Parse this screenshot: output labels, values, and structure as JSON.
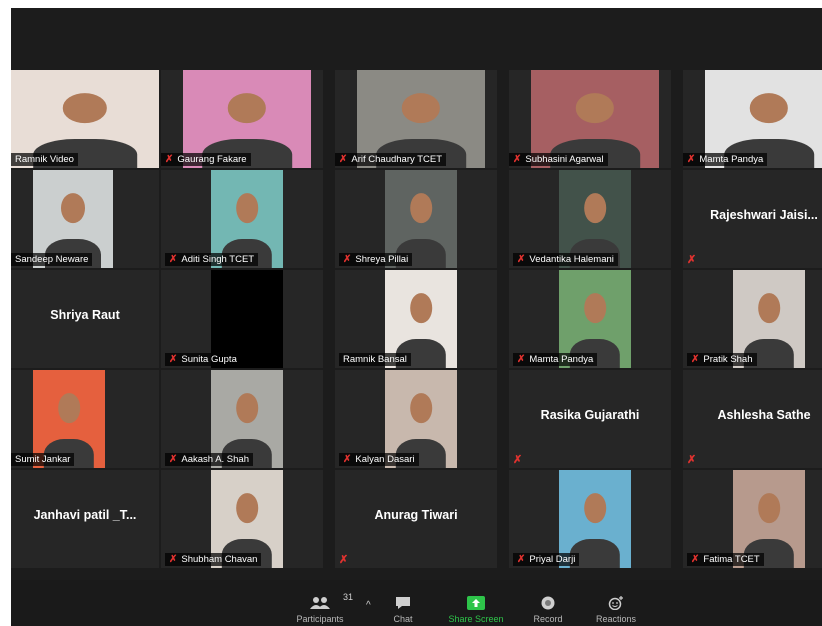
{
  "participants": [
    {
      "name": "Ramnik Video",
      "muted": false,
      "video": true,
      "active": true,
      "bg": "#e8ddd6"
    },
    {
      "name": "Gaurang Fakare",
      "muted": true,
      "video": true,
      "bg": "#d98ab7"
    },
    {
      "name": "Arif Chaudhary TCET",
      "muted": true,
      "video": true,
      "bg": "#8b8a84"
    },
    {
      "name": "Subhasini Agarwal",
      "muted": true,
      "video": true,
      "bg": "#a65f62"
    },
    {
      "name": "Mamta Pandya",
      "muted": true,
      "video": true,
      "bg": "#e2e2e2"
    },
    {
      "name": "Sandeep Neware",
      "muted": false,
      "video": true,
      "bg": "#cbcfcf"
    },
    {
      "name": "Aditi Singh TCET",
      "muted": true,
      "video": true,
      "bg": "#73b7b3"
    },
    {
      "name": "Shreya Pillai",
      "muted": true,
      "video": true,
      "bg": "#5f6461"
    },
    {
      "name": "Vedantika Halemani",
      "muted": true,
      "video": true,
      "bg": "#42524a"
    },
    {
      "name": "Rajeshwari  Jaisi...",
      "muted": true,
      "video": false
    },
    {
      "name": "Shriya Raut",
      "muted": false,
      "video": false
    },
    {
      "name": "Sunita Gupta",
      "muted": true,
      "video": true,
      "bg": "#000000"
    },
    {
      "name": "Ramnik Bansal",
      "muted": false,
      "video": true,
      "bg": "#e9e4df"
    },
    {
      "name": "Mamta Pandya",
      "muted": true,
      "video": true,
      "bg": "#6fa06b"
    },
    {
      "name": "Pratik Shah",
      "muted": true,
      "video": true,
      "bg": "#cfc9c4"
    },
    {
      "name": "Sumit Jankar",
      "muted": false,
      "video": true,
      "bg": "#e5603e"
    },
    {
      "name": "Aakash A. Shah",
      "muted": true,
      "video": true,
      "bg": "#a9a9a4"
    },
    {
      "name": "Kalyan Dasari",
      "muted": true,
      "video": true,
      "bg": "#c8b8ad"
    },
    {
      "name": "Rasika Gujarathi",
      "muted": true,
      "video": false
    },
    {
      "name": "Ashlesha Sathe",
      "muted": true,
      "video": false
    },
    {
      "name": "Janhavi patil _T...",
      "muted": false,
      "video": false
    },
    {
      "name": "Shubham Chavan",
      "muted": true,
      "video": true,
      "bg": "#d7d0c8"
    },
    {
      "name": "Anurag Tiwari",
      "muted": true,
      "video": false
    },
    {
      "name": "Priyal Darji",
      "muted": true,
      "video": true,
      "bg": "#6ab0cf"
    },
    {
      "name": "Fatima TCET",
      "muted": true,
      "video": true,
      "bg": "#b79a8d"
    }
  ],
  "toolbar": {
    "participants_label": "Participants",
    "participants_count": "31",
    "chat_label": "Chat",
    "share_label": "Share Screen",
    "record_label": "Record",
    "reactions_label": "Reactions"
  }
}
